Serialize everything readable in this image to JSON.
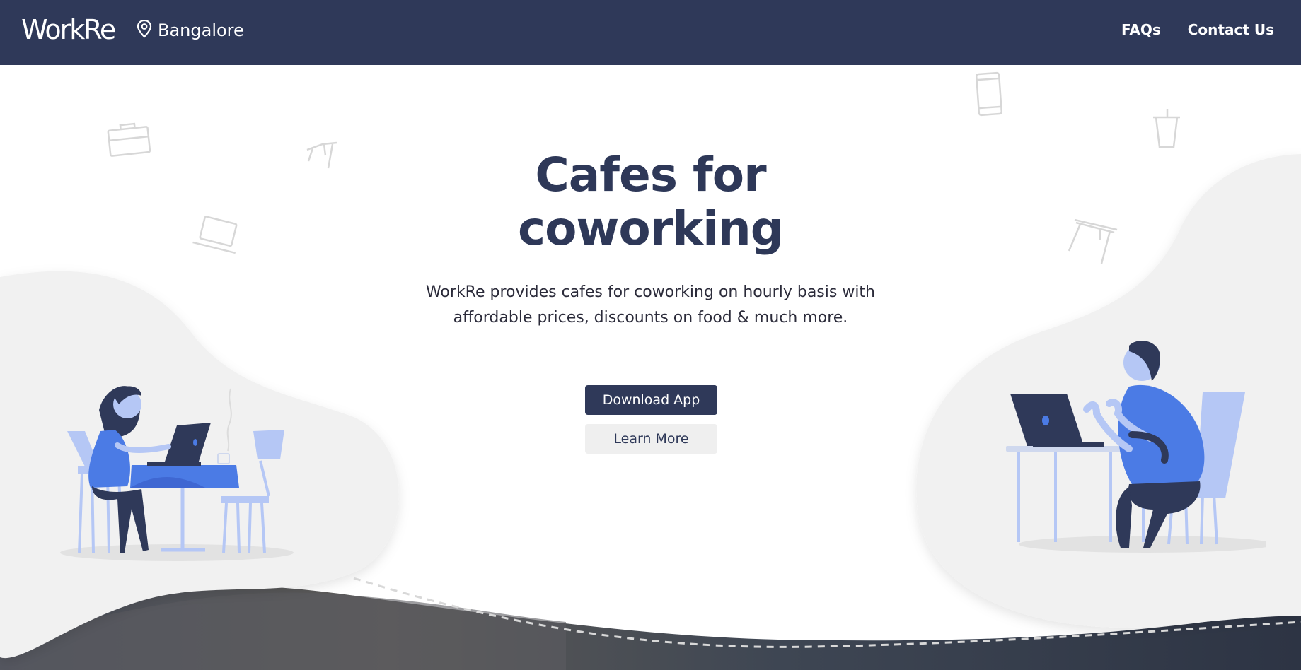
{
  "header": {
    "logo": "WorkRe",
    "location": "Bangalore",
    "nav": [
      {
        "label": "FAQs"
      },
      {
        "label": "Contact Us"
      }
    ]
  },
  "hero": {
    "title_line1": "Cafes for",
    "title_line2": "coworking",
    "description": "WorkRe provides cafes for coworking on hourly basis with affordable prices, discounts on food & much more.",
    "primary_button": "Download App",
    "secondary_button": "Learn More"
  },
  "colors": {
    "navy": "#2f3959",
    "accent_blue": "#4b7be5",
    "light_blue": "#b5c7f5",
    "blob_gray": "#f1f1f1"
  }
}
